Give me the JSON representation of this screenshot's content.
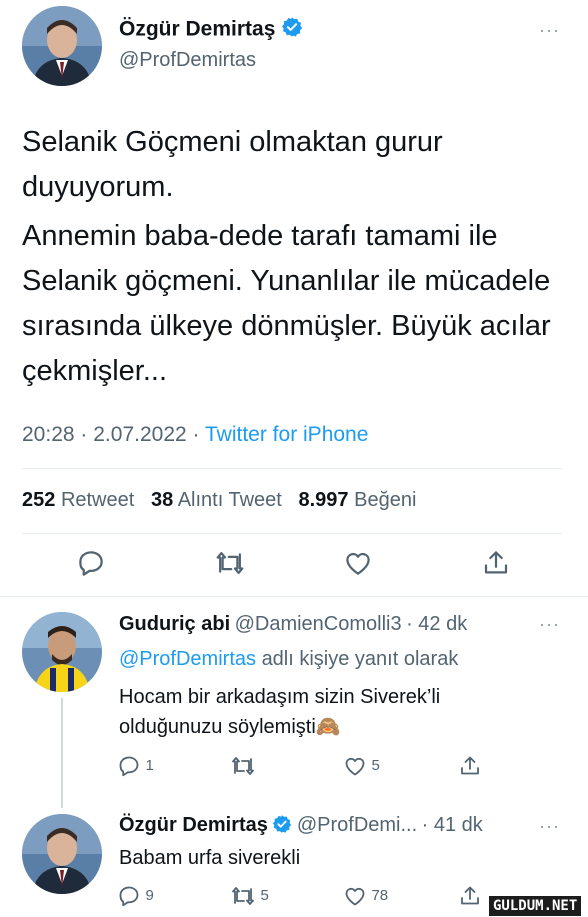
{
  "main_tweet": {
    "author_name": "Özgür Demirtaş",
    "author_handle": "@ProfDemirtas",
    "more": "···",
    "text_paragraph_1": "Selanik Göçmeni olmaktan gurur duyuyorum.",
    "text_paragraph_2": "Annemin baba-dede tarafı tamami ile Selanik göçmeni. Yunanlılar ile mücadele sırasında ülkeye dönmüşler. Büyük acılar çekmişler...",
    "time": "20:28",
    "date": "2.07.2022",
    "separator": "·",
    "source": "Twitter for iPhone",
    "retweet_count": "252",
    "retweet_label": "Retweet",
    "quote_count": "38",
    "quote_label": "Alıntı Tweet",
    "like_count": "8.997",
    "like_label": "Beğeni"
  },
  "reply_1": {
    "author_name": "Guduriç abi",
    "author_handle": "@DamienComolli3",
    "time_ago": "· 42 dk",
    "more": "···",
    "reply_to_handle": "@ProfDemirtas",
    "reply_to_suffix": "adlı kişiye yanıt olarak",
    "text_line_1": "Hocam bir arkadaşım sizin Siverek’li",
    "text_line_2": "olduğunuzu söylemişti",
    "emoji": "🙈",
    "reply_count": "1",
    "retweet_count": "",
    "like_count": "5"
  },
  "reply_2": {
    "author_name": "Özgür Demirtaş",
    "author_handle": "@ProfDemi...",
    "time_ago": "· 41 dk",
    "more": "···",
    "text": "Babam urfa siverekli",
    "reply_count": "9",
    "retweet_count": "5",
    "like_count": "78"
  },
  "watermark": "GULDUM.NET",
  "colors": {
    "accent": "#1d9bf0",
    "text": "#0f1419",
    "secondary": "#536471",
    "divider": "#e6ecf0"
  }
}
